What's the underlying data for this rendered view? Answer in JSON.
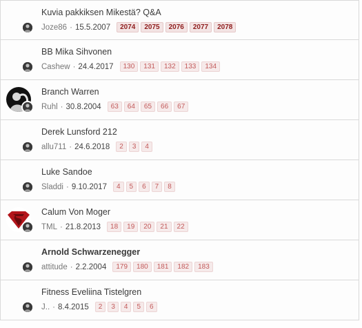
{
  "threads": [
    {
      "title": "Kuvia pakkiksen Mikestä? Q&A",
      "author": "Joze86",
      "date": "15.5.2007",
      "pages": [
        "2074",
        "2075",
        "2076",
        "2077",
        "2078"
      ],
      "bold_title": false,
      "avatar": "none"
    },
    {
      "title": "BB Mika Sihvonen",
      "author": "Cashew",
      "date": "24.4.2017",
      "pages": [
        "130",
        "131",
        "132",
        "133",
        "134"
      ],
      "bold_title": false,
      "avatar": "none"
    },
    {
      "title": "Branch Warren",
      "author": "Ruhl",
      "date": "30.8.2004",
      "pages": [
        "63",
        "64",
        "65",
        "66",
        "67"
      ],
      "bold_title": false,
      "avatar": "dark-figure"
    },
    {
      "title": "Derek Lunsford 212",
      "author": "allu711",
      "date": "24.6.2018",
      "pages": [
        "2",
        "3",
        "4"
      ],
      "bold_title": false,
      "avatar": "none"
    },
    {
      "title": "Luke Sandoe",
      "author": "Sladdi",
      "date": "9.10.2017",
      "pages": [
        "4",
        "5",
        "6",
        "7",
        "8"
      ],
      "bold_title": false,
      "avatar": "none"
    },
    {
      "title": "Calum Von Moger",
      "author": "TML",
      "date": "21.8.2013",
      "pages": [
        "18",
        "19",
        "20",
        "21",
        "22"
      ],
      "bold_title": false,
      "avatar": "superman-logo"
    },
    {
      "title": "Arnold Schwarzenegger",
      "author": "attitude",
      "date": "2.2.2004",
      "pages": [
        "179",
        "180",
        "181",
        "182",
        "183"
      ],
      "bold_title": true,
      "avatar": "none"
    },
    {
      "title": "Fitness Eveliina Tistelgren",
      "author": "J..",
      "date": "8.4.2015",
      "pages": [
        "2",
        "3",
        "4",
        "5",
        "6"
      ],
      "bold_title": false,
      "avatar": "none"
    }
  ],
  "meta_separator": "·",
  "colors": {
    "page_link": "#c25a5a",
    "page_link_strong": "#8f1d1d",
    "border": "#d9d9d9"
  }
}
